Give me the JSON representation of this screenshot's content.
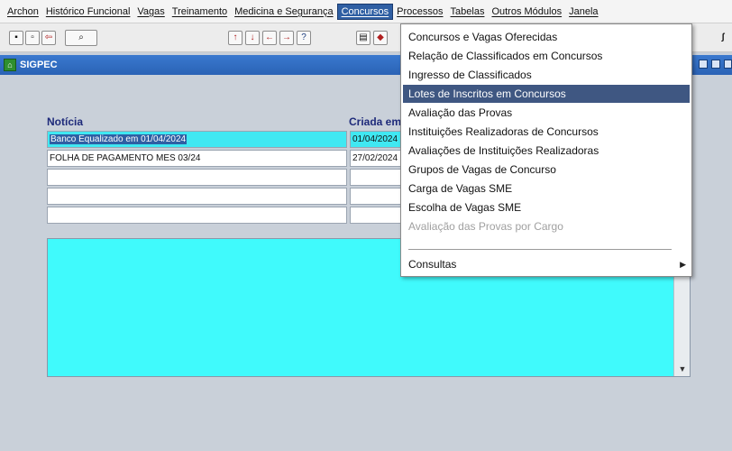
{
  "menu": {
    "items": [
      {
        "label": "Archon"
      },
      {
        "label": "Histórico Funcional"
      },
      {
        "label": "Vagas"
      },
      {
        "label": "Treinamento"
      },
      {
        "label": "Medicina e Segurança"
      },
      {
        "label": "Concursos"
      },
      {
        "label": "Processos"
      },
      {
        "label": "Tabelas"
      },
      {
        "label": "Outros Módulos"
      },
      {
        "label": "Janela"
      }
    ],
    "active": "Concursos"
  },
  "window": {
    "title": "SIGPEC"
  },
  "form": {
    "headers": {
      "noticia": "Notícia",
      "criada": "Criada em"
    },
    "rows": [
      {
        "noticia": "Banco Equalizado em 01/04/2024",
        "criada": "01/04/2024"
      },
      {
        "noticia": "FOLHA DE PAGAMENTO MES 03/24",
        "criada": "27/02/2024"
      },
      {
        "noticia": "",
        "criada": ""
      },
      {
        "noticia": "",
        "criada": ""
      },
      {
        "noticia": "",
        "criada": ""
      }
    ]
  },
  "dropdown": {
    "items": [
      {
        "label": "Concursos e Vagas Oferecidas"
      },
      {
        "label": "Relação de Classificados em Concursos"
      },
      {
        "label": "Ingresso de Classificados"
      },
      {
        "label": "Lotes de Inscritos em Concursos"
      },
      {
        "label": "Avaliação das Provas"
      },
      {
        "label": "Instituições Realizadoras de Concursos"
      },
      {
        "label": "Avaliações de Instituições Realizadoras"
      },
      {
        "label": "Grupos de Vagas de Concurso"
      },
      {
        "label": "Carga de Vagas SME"
      },
      {
        "label": "Escolha de Vagas SME"
      },
      {
        "label": "Avaliação das Provas por Cargo"
      },
      {
        "label": "Consultas"
      }
    ],
    "highlighted": "Lotes de Inscritos em Concursos",
    "disabled": [
      "Avaliação das Provas por Cargo"
    ]
  },
  "colors": {
    "accent": "#2f5fa3",
    "title_bar": "#2a62b5",
    "field_highlight": "#40e8f2",
    "menu_highlight": "#3f5782"
  }
}
